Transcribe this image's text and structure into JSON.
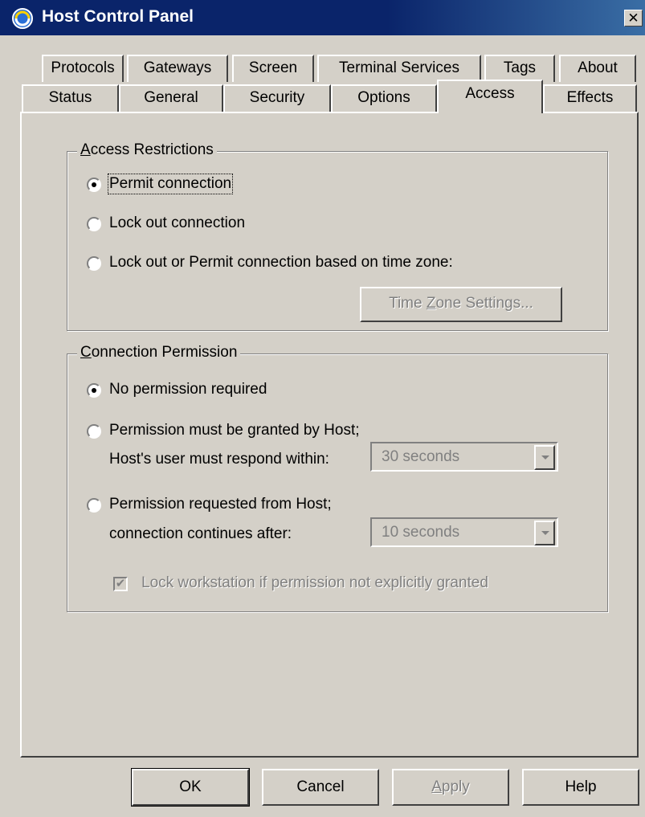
{
  "window": {
    "title": "Host Control Panel",
    "close_label": "✕"
  },
  "tabs_row1": [
    "Protocols",
    "Gateways",
    "Screen",
    "Terminal Services",
    "Tags",
    "About"
  ],
  "tabs_row2": [
    "Status",
    "General",
    "Security",
    "Options",
    "Access",
    "Effects"
  ],
  "active_tab": "Access",
  "access_restrictions": {
    "legend_first": "A",
    "legend_rest": "ccess Restrictions",
    "options": [
      "Permit connection",
      "Lock out connection",
      "Lock out or Permit connection based on time zone:"
    ],
    "selected": "Permit connection",
    "tz_button_pre": "Time ",
    "tz_button_u": "Z",
    "tz_button_post": "one Settings..."
  },
  "connection_permission": {
    "legend_first": "C",
    "legend_rest": "onnection Permission",
    "option1": "No permission required",
    "option2": "Permission must be granted by Host;",
    "option2_sub": "Host's user must respond within:",
    "option2_value": "30 seconds",
    "option3": "Permission requested from Host;",
    "option3_sub": "connection continues after:",
    "option3_value": "10 seconds",
    "selected": "No permission required",
    "lock_label": "Lock workstation if permission not explicitly granted",
    "lock_checked": true,
    "lock_check_glyph": "✔"
  },
  "buttons": {
    "ok": "OK",
    "cancel": "Cancel",
    "apply_u": "A",
    "apply_rest": "pply",
    "help": "Help"
  }
}
